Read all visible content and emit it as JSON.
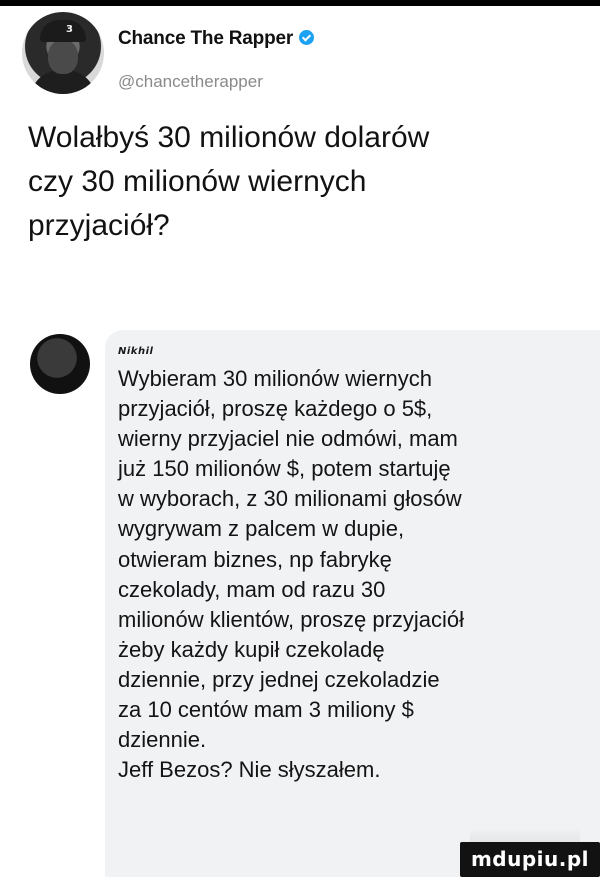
{
  "tweet": {
    "display_name": "Chance The Rapper",
    "handle": "@chancetherapper",
    "avatar_cap_number": "3",
    "text_lines": [
      "Wolałbyś 30 milionów dolarów",
      "czy 30 milionów wiernych",
      "przyjaciół?"
    ]
  },
  "comment": {
    "author": "Nikhil",
    "text_lines": [
      "Wybieram 30 milionów wiernych",
      "przyjaciół, proszę każdego o 5$,",
      "wierny przyjaciel nie odmówi, mam",
      "już 150 milionów $, potem startuję",
      "w wyborach, z 30 milionami głosów",
      "wygrywam z palcem w dupie,",
      "otwieram biznes, np fabrykę",
      "czekolady, mam od razu 30",
      "milionów klientów, proszę przyjaciół",
      "żeby każdy kupił czekoladę",
      "dziennie, przy jednej czekoladzie",
      "za 10 centów mam 3 miliony $",
      "dziennie.",
      "Jeff Bezos? Nie słyszałem."
    ]
  },
  "watermark": {
    "text": "mdupiu.pl"
  },
  "colors": {
    "verified": "#1da1f2",
    "card_background": "#f1f2f4",
    "handle_gray": "#8a8a8a"
  }
}
